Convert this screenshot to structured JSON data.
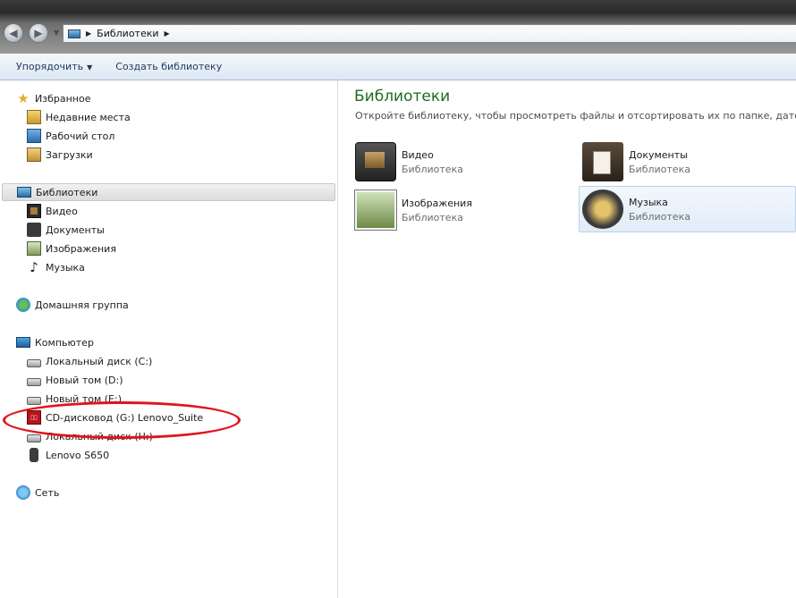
{
  "address": {
    "crumbs": [
      "Библиотеки"
    ]
  },
  "toolbar": {
    "organize_label": "Упорядочить",
    "create_library_label": "Создать библиотеку"
  },
  "nav": {
    "favorites": {
      "label": "Избранное",
      "items": [
        "Недавние места",
        "Рабочий стол",
        "Загрузки"
      ]
    },
    "libraries": {
      "label": "Библиотеки",
      "items": [
        "Видео",
        "Документы",
        "Изображения",
        "Музыка"
      ]
    },
    "homegroup": {
      "label": "Домашняя группа"
    },
    "computer": {
      "label": "Компьютер",
      "items": [
        "Локальный диск (C:)",
        "Новый том (D:)",
        "Новый том (E:)",
        "CD-дисковод (G:) Lenovo_Suite",
        "Локальный диск (H:)",
        "Lenovo S650"
      ]
    },
    "network": {
      "label": "Сеть"
    }
  },
  "content": {
    "title": "Библиотеки",
    "subtitle": "Откройте библиотеку, чтобы просмотреть файлы и отсортировать их по папке, дате и др",
    "tiles": [
      {
        "name": "Видео",
        "type": "Библиотека"
      },
      {
        "name": "Документы",
        "type": "Библиотека"
      },
      {
        "name": "Изображения",
        "type": "Библиотека"
      },
      {
        "name": "Музыка",
        "type": "Библиотека"
      }
    ]
  },
  "colors": {
    "title_green": "#1e6b22",
    "annotation_red": "#e0141c",
    "selection_gray": "#dcdcdc",
    "hover_blue": "#e1ecf8"
  }
}
